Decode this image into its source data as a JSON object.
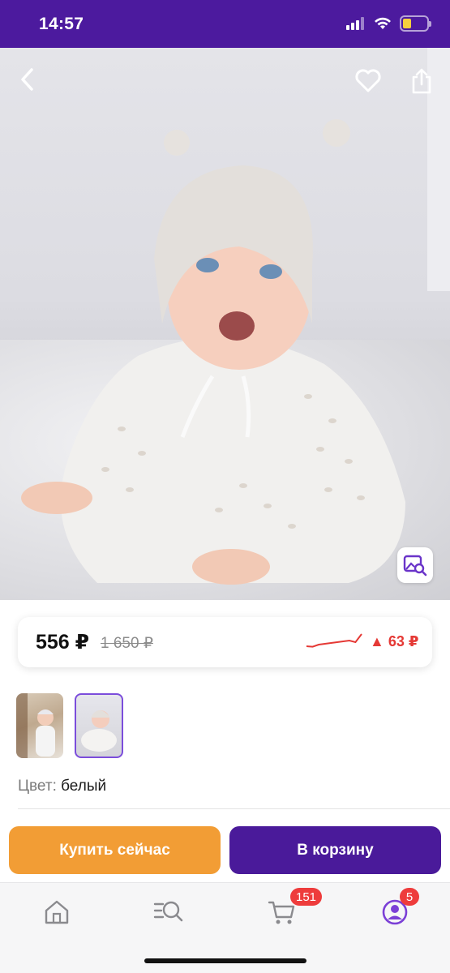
{
  "status_bar": {
    "time": "14:57",
    "battery_level": 0.35,
    "battery_color": "#f5cf3d"
  },
  "header": {
    "back_icon": "chevron-left-icon",
    "favorite_icon": "heart-icon",
    "share_icon": "share-icon"
  },
  "product": {
    "photo_alt": "Baby in white knitted hat and sweater",
    "visual_search_icon": "image-search-icon",
    "price": "556 ₽",
    "old_price": "1 650 ₽",
    "price_change": "▲ 63 ₽",
    "price_change_color": "#e53935",
    "price_history": [
      0.25,
      0.22,
      0.35,
      0.4,
      0.45,
      0.5,
      0.55,
      0.6,
      0.5,
      1.0
    ],
    "thumbnails": [
      {
        "name": "thumb-1",
        "selected": false
      },
      {
        "name": "thumb-2",
        "selected": true
      }
    ],
    "color_label": "Цвет:",
    "color_value": "белый"
  },
  "actions": {
    "buy_now": "Купить сейчас",
    "add_to_cart": "В корзину",
    "buy_now_color": "#f29d35",
    "add_to_cart_color": "#4a1a9a"
  },
  "tab_bar": {
    "home_icon": "home-icon",
    "catalog_icon": "catalog-search-icon",
    "cart_icon": "cart-icon",
    "cart_badge": "151",
    "profile_icon": "profile-icon",
    "profile_badge": "5",
    "accent": "#7b3fd6"
  }
}
